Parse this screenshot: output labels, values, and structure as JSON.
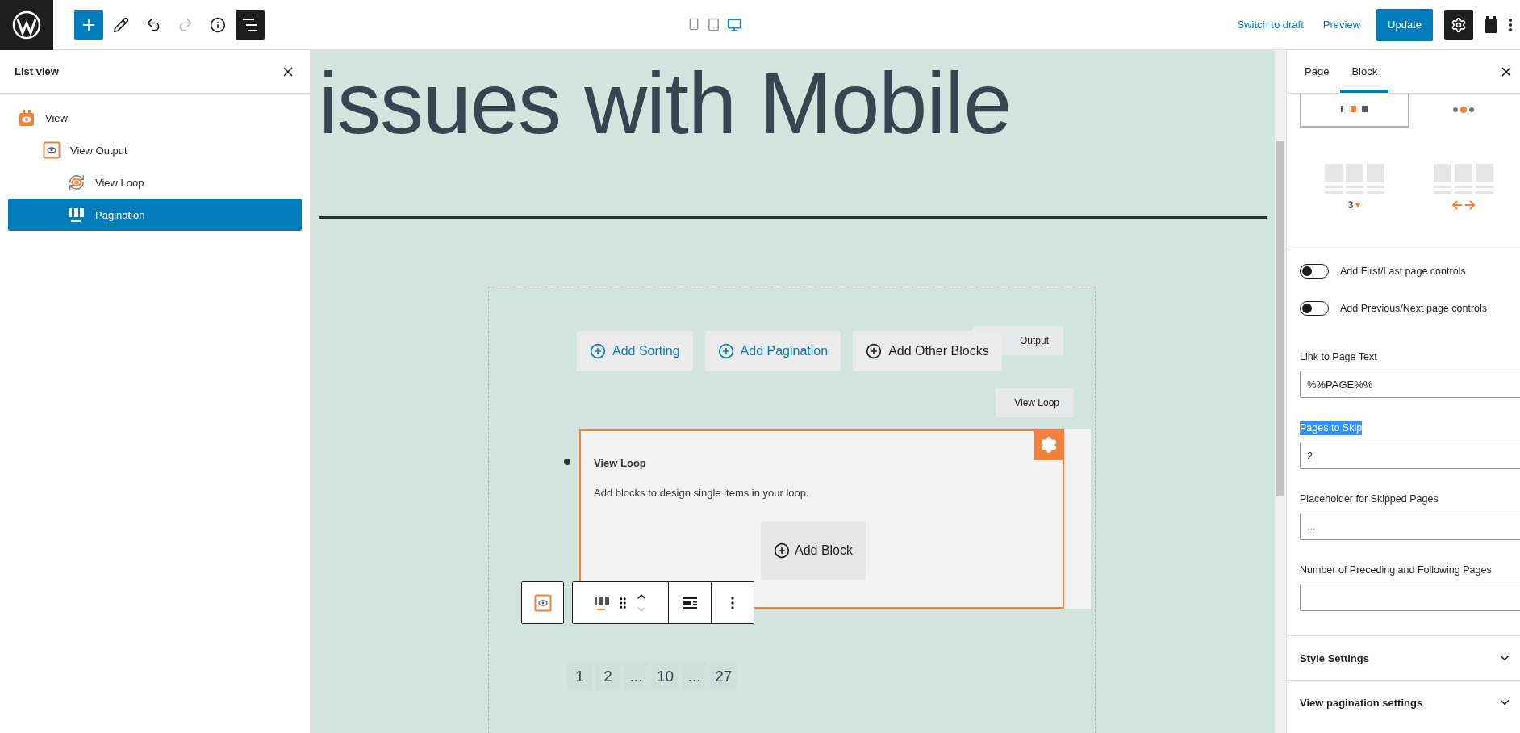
{
  "top_bar": {
    "tools": [
      {
        "kind": "add",
        "disabled": false
      },
      {
        "kind": "edit",
        "disabled": false
      },
      {
        "kind": "undo",
        "disabled": false
      },
      {
        "kind": "redo",
        "disabled": true
      },
      {
        "kind": "info",
        "disabled": false
      }
    ],
    "list_view_toggle": {
      "on": true
    },
    "devices": [
      {
        "kind": "mobile",
        "selected": false
      },
      {
        "kind": "tablet",
        "selected": false
      },
      {
        "kind": "desktop",
        "selected": true
      }
    ],
    "switch_to_draft": "Switch to draft",
    "preview": "Preview",
    "update": "Update",
    "settings_toggle": {
      "on": true
    }
  },
  "list_view": {
    "title": "List view",
    "items": [
      {
        "label": "View",
        "kind": "view",
        "selected": false,
        "children": [
          {
            "label": "View Output",
            "kind": "output",
            "selected": false,
            "children": [
              {
                "label": "View Loop",
                "kind": "loop",
                "selected": false
              },
              {
                "label": "Pagination",
                "kind": "pagination",
                "selected": true
              }
            ]
          }
        ]
      }
    ]
  },
  "canvas": {
    "heading": "issues with Mobile",
    "inserter_buttons": [
      {
        "label": "Add Sorting",
        "kind": "accent"
      },
      {
        "label": "Add Pagination",
        "kind": "accent"
      },
      {
        "label": "Add Other Blocks",
        "kind": "plain"
      }
    ],
    "output_tag": "Output",
    "loop_tag": "View Loop",
    "loop_card": {
      "title": "View Loop",
      "description": "Add blocks to design single items in your loop.",
      "add_button": "Add Block"
    },
    "pagination": [
      "1",
      "2",
      "...",
      "10",
      "...",
      "27"
    ]
  },
  "sidebar": {
    "tabs": [
      {
        "label": "Page",
        "selected": false
      },
      {
        "label": "Block",
        "selected": true
      }
    ],
    "style_previews": [
      {
        "kind": "numbers",
        "selected": true
      },
      {
        "kind": "dots",
        "selected": false
      },
      {
        "kind": "count",
        "label": "3",
        "selected": false
      },
      {
        "kind": "arrows",
        "selected": false
      }
    ],
    "toggles": [
      {
        "label": "Add First/Last page controls",
        "on": false
      },
      {
        "label": "Add Previous/Next page controls",
        "on": false
      }
    ],
    "fields": [
      {
        "label": "Link to Page Text",
        "value": "%%PAGE%%",
        "highlighted": false
      },
      {
        "label": "Pages to Skip",
        "value": "2",
        "highlighted": true
      },
      {
        "label": "Placeholder for Skipped Pages",
        "value": "...",
        "highlighted": false
      },
      {
        "label": "Number of Preceding and Following Pages",
        "highlighted": false
      }
    ],
    "sections": [
      {
        "label": "Style Settings",
        "expanded": false
      },
      {
        "label": "View pagination settings",
        "expanded": false
      }
    ]
  }
}
